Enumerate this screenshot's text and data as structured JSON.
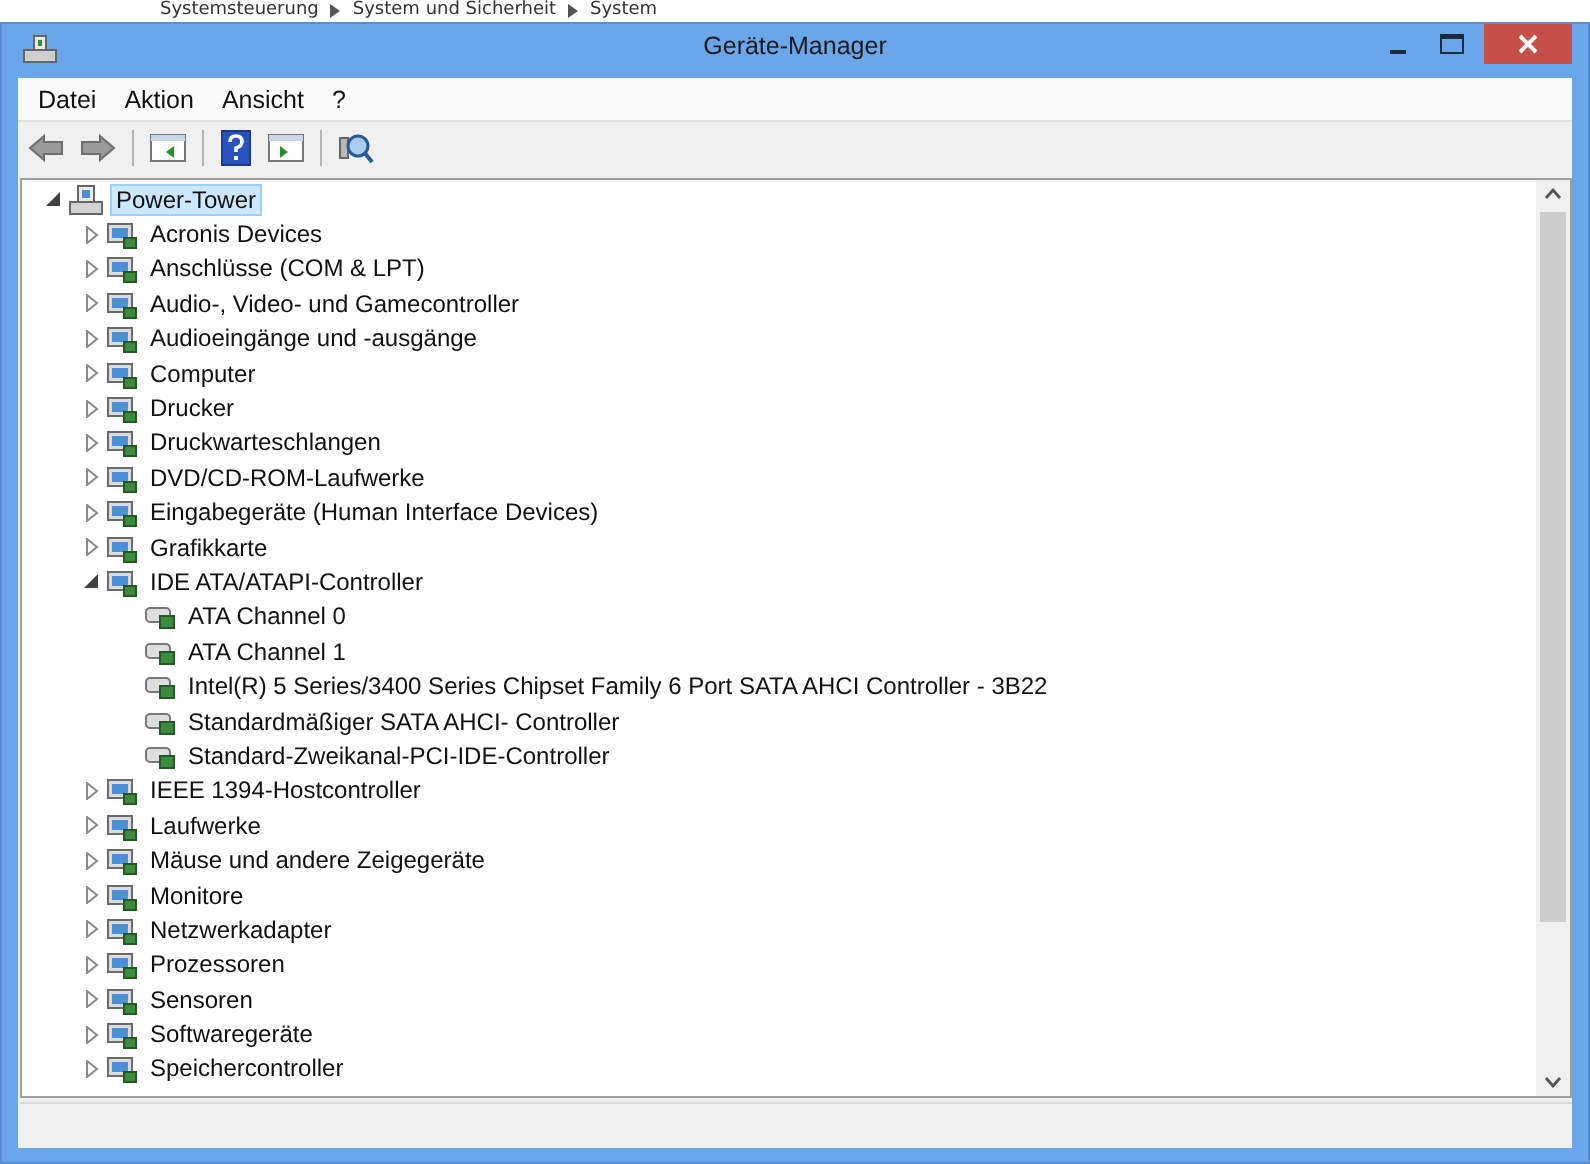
{
  "background_breadcrumb": [
    "Systemsteuerung",
    "System und Sicherheit",
    "System"
  ],
  "window": {
    "title": "Geräte-Manager"
  },
  "menu": [
    "Datei",
    "Aktion",
    "Ansicht",
    "?"
  ],
  "tree": [
    {
      "label": "Power-Tower",
      "expanded": true,
      "selected": true,
      "children": [
        {
          "label": "Acronis Devices",
          "expanded": false
        },
        {
          "label": "Anschlüsse (COM & LPT)",
          "expanded": false
        },
        {
          "label": "Audio-, Video- und Gamecontroller",
          "expanded": false
        },
        {
          "label": "Audioeingänge und -ausgänge",
          "expanded": false
        },
        {
          "label": "Computer",
          "expanded": false
        },
        {
          "label": "Drucker",
          "expanded": false
        },
        {
          "label": "Druckwarteschlangen",
          "expanded": false
        },
        {
          "label": "DVD/CD-ROM-Laufwerke",
          "expanded": false
        },
        {
          "label": "Eingabegeräte (Human Interface Devices)",
          "expanded": false
        },
        {
          "label": "Grafikkarte",
          "expanded": false
        },
        {
          "label": "IDE ATA/ATAPI-Controller",
          "expanded": true,
          "children": [
            {
              "label": "ATA Channel 0"
            },
            {
              "label": "ATA Channel 1"
            },
            {
              "label": "Intel(R) 5 Series/3400 Series Chipset Family 6 Port SATA AHCI Controller - 3B22"
            },
            {
              "label": "Standardmäßiger SATA AHCI- Controller"
            },
            {
              "label": "Standard-Zweikanal-PCI-IDE-Controller"
            }
          ]
        },
        {
          "label": "IEEE 1394-Hostcontroller",
          "expanded": false
        },
        {
          "label": "Laufwerke",
          "expanded": false
        },
        {
          "label": "Mäuse und andere Zeigegeräte",
          "expanded": false
        },
        {
          "label": "Monitore",
          "expanded": false
        },
        {
          "label": "Netzwerkadapter",
          "expanded": false
        },
        {
          "label": "Prozessoren",
          "expanded": false
        },
        {
          "label": "Sensoren",
          "expanded": false
        },
        {
          "label": "Softwaregeräte",
          "expanded": false
        },
        {
          "label": "Speichercontroller",
          "expanded": false
        }
      ]
    }
  ]
}
